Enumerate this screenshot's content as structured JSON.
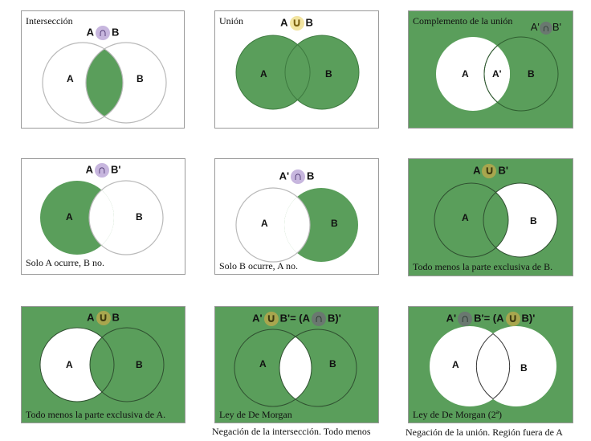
{
  "colors": {
    "green": "#5a9e5b",
    "white": "#ffffff",
    "outline_light": "#b9b9b9",
    "outline_dark": "#3a3a3a"
  },
  "panels": [
    {
      "title": "Intersección",
      "caption": "",
      "notation": [
        "A",
        "∩",
        "B"
      ],
      "op_style": "purple",
      "labels": {
        "a": "A",
        "b": "B"
      }
    },
    {
      "title": "Unión",
      "caption": "",
      "notation": [
        "A",
        "∪",
        "B"
      ],
      "op_style": "yellow",
      "labels": {
        "a": "A",
        "b": "B"
      }
    },
    {
      "title": "Complemento de la unión",
      "caption": "",
      "notation": [
        "A'",
        "∩",
        "B'"
      ],
      "op_style": "gray",
      "labels": {
        "a": "A",
        "mid": "A'",
        "b": "B"
      }
    },
    {
      "title": "",
      "caption": "Solo A ocurre, B no.",
      "notation": [
        "A",
        "∩",
        "B'"
      ],
      "op_style": "purple",
      "labels": {
        "a": "A",
        "b": "B"
      }
    },
    {
      "title": "",
      "caption": "Solo B ocurre, A no.",
      "notation": [
        "A'",
        "∩",
        "B"
      ],
      "op_style": "purple",
      "labels": {
        "a": "A",
        "b": "B"
      }
    },
    {
      "title": "",
      "caption": "Todo menos la parte exclusiva de B.",
      "notation": [
        "A",
        "∪",
        "B'"
      ],
      "op_style": "olive",
      "labels": {
        "a": "A",
        "b": "B"
      }
    },
    {
      "title": "",
      "caption": "Todo menos la parte exclusiva de A.",
      "notation": [
        "A",
        "∪",
        "B"
      ],
      "op_style": "olive",
      "labels": {
        "a": "A",
        "b": "B"
      }
    },
    {
      "title": "",
      "caption": "Ley de De Morgan",
      "notation": [
        "A'",
        "∪",
        "B'= (A",
        "∩",
        "B)'"
      ],
      "op_styles": [
        "olive",
        "gray"
      ],
      "labels": {
        "a": "A",
        "b": "B"
      }
    },
    {
      "title": "",
      "caption": "Ley de De Morgan (2ª)",
      "notation": [
        "A'",
        "∩",
        "B'= (A",
        "∪",
        "B)'"
      ],
      "op_styles": [
        "gray",
        "olive"
      ],
      "labels": {
        "a": "A",
        "b": "B"
      }
    }
  ],
  "outer_captions": [
    "Negación de la intersección. Todo menos",
    "Negación de la unión. Región fuera de A"
  ]
}
